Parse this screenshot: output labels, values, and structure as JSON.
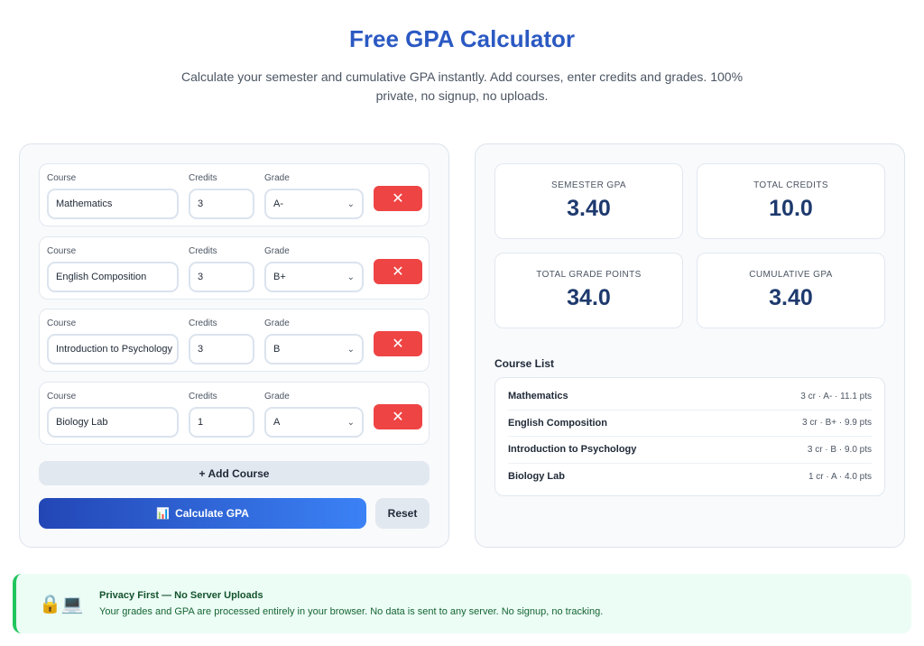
{
  "header": {
    "title": "Free GPA Calculator",
    "subtitle": "Calculate your semester and cumulative GPA instantly. Add courses, enter credits and grades. 100% private, no signup, no uploads."
  },
  "form": {
    "labels": {
      "course": "Course",
      "credits": "Credits",
      "grade": "Grade"
    },
    "courses": [
      {
        "course": "Mathematics",
        "credits": "3",
        "grade": "A-"
      },
      {
        "course": "English Composition",
        "credits": "3",
        "grade": "B+"
      },
      {
        "course": "Introduction to Psychology",
        "credits": "3",
        "grade": "B"
      },
      {
        "course": "Biology Lab",
        "credits": "1",
        "grade": "A"
      }
    ],
    "remove_symbol": "✕",
    "add_label": "+ Add Course",
    "calc_icon": "📊",
    "calc_label": "Calculate GPA",
    "reset_label": "Reset"
  },
  "results": {
    "semester_gpa_label": "SEMESTER GPA",
    "semester_gpa": "3.40",
    "total_credits_label": "TOTAL CREDITS",
    "total_credits": "10.0",
    "total_points_label": "TOTAL GRADE POINTS",
    "total_points": "34.0",
    "cumulative_gpa_label": "CUMULATIVE GPA",
    "cumulative_gpa": "3.40",
    "course_list_title": "Course List",
    "course_list": [
      {
        "name": "Mathematics",
        "detail": "3 cr · A- · 11.1 pts"
      },
      {
        "name": "English Composition",
        "detail": "3 cr · B+ · 9.9 pts"
      },
      {
        "name": "Introduction to Psychology",
        "detail": "3 cr · B · 9.0 pts"
      },
      {
        "name": "Biology Lab",
        "detail": "1 cr · A · 4.0 pts"
      }
    ]
  },
  "privacy": {
    "icons": "🔒💻",
    "title": "Privacy First — No Server Uploads",
    "text": "Your grades and GPA are processed entirely in your browser. No data is sent to any server. No signup, no tracking."
  },
  "colors": {
    "title": "#2b59c3",
    "remove": "#ef4444",
    "calc_start": "#2346b5",
    "calc_end": "#3b82f6",
    "privacy_bg": "#ecfdf5",
    "privacy_border": "#22c55e"
  }
}
